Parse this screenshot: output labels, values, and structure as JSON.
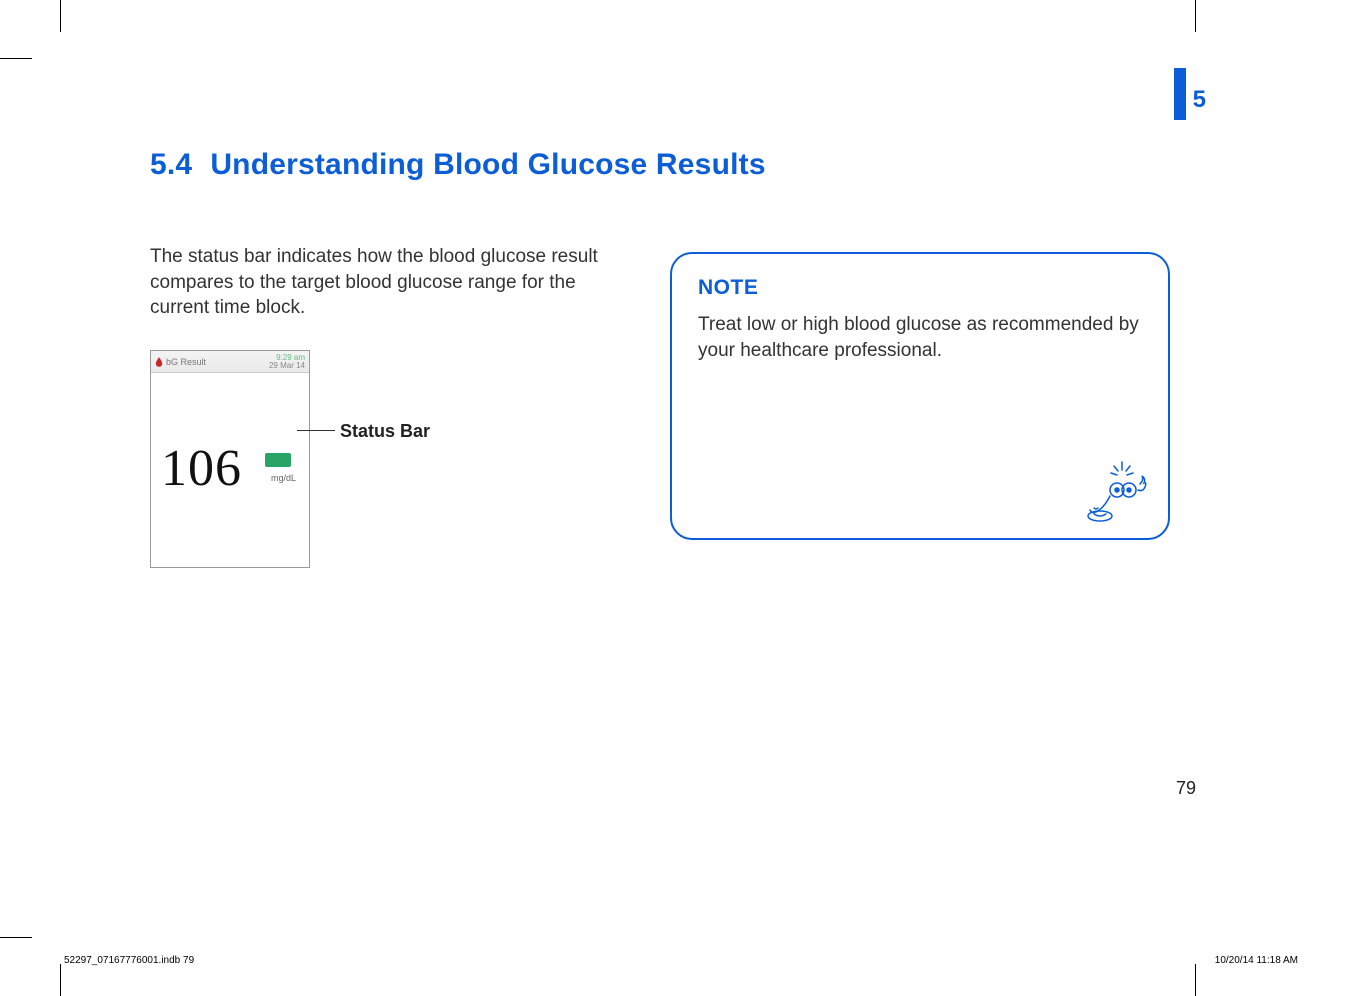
{
  "chapter": {
    "number": "5"
  },
  "heading": {
    "number": "5.4",
    "title": "Understanding Blood Glucose Results"
  },
  "body_text": "The status bar indicates how the blood glucose result compares to the target blood glucose range for the current time block.",
  "device": {
    "header_label": "bG Result",
    "time": "9:29 am",
    "date": "29 Mar 14",
    "reading": "106",
    "unit": "mg/dL",
    "status_color": "#2aa366"
  },
  "callout": {
    "label": "Status Bar"
  },
  "note": {
    "title": "NOTE",
    "body": "Treat low or high blood glucose as recommended by your healthcare professional."
  },
  "page_number": "79",
  "footer": {
    "left": "52297_07167776001.indb   79",
    "right": "10/20/14   11:18 AM"
  }
}
